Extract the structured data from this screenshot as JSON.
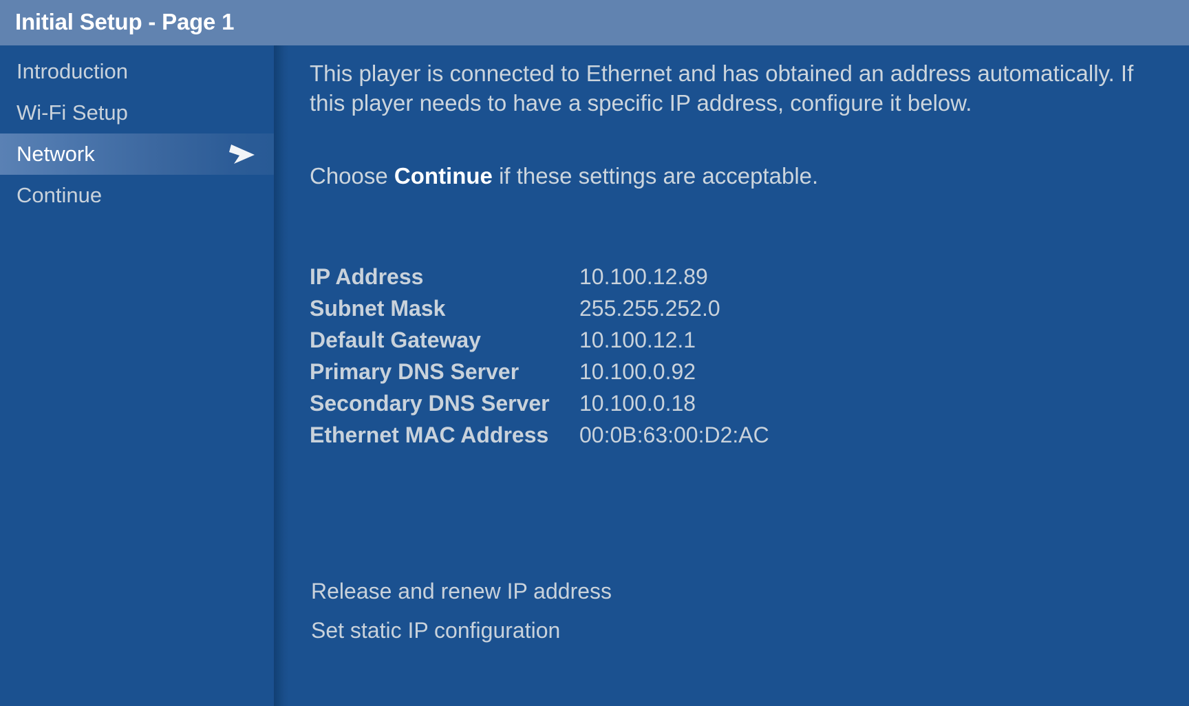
{
  "titlebar": {
    "title": "Initial Setup - Page 1"
  },
  "colors": {
    "titlebar_background": "#6183b0",
    "page_background": "#1b5190",
    "selected_highlight": "#5a81b4",
    "text_primary": "#c9d2db",
    "text_emphasis": "#ffffff"
  },
  "sidebar": {
    "items": [
      {
        "label": "Introduction",
        "selected": false
      },
      {
        "label": "Wi-Fi Setup",
        "selected": false
      },
      {
        "label": "Network",
        "selected": true,
        "icon": "arrow-right-icon"
      },
      {
        "label": "Continue",
        "selected": false
      }
    ]
  },
  "content": {
    "intro_paragraph_part1": "This player is connected to Ethernet and has obtained an address automatically. If this player needs to have a specific IP address, configure it below.",
    "choose_prefix": "Choose ",
    "choose_emphasis": "Continue",
    "choose_suffix": " if these settings are acceptable.",
    "info_rows": [
      {
        "label": "IP Address",
        "value": "10.100.12.89"
      },
      {
        "label": "Subnet Mask",
        "value": "255.255.252.0"
      },
      {
        "label": "Default Gateway",
        "value": "10.100.12.1"
      },
      {
        "label": "Primary DNS Server",
        "value": "10.100.0.92"
      },
      {
        "label": "Secondary DNS Server",
        "value": "10.100.0.18"
      },
      {
        "label": "Ethernet MAC Address",
        "value": "00:0B:63:00:D2:AC"
      }
    ],
    "actions": [
      {
        "label": "Release and renew IP address"
      },
      {
        "label": "Set static IP configuration"
      }
    ]
  }
}
